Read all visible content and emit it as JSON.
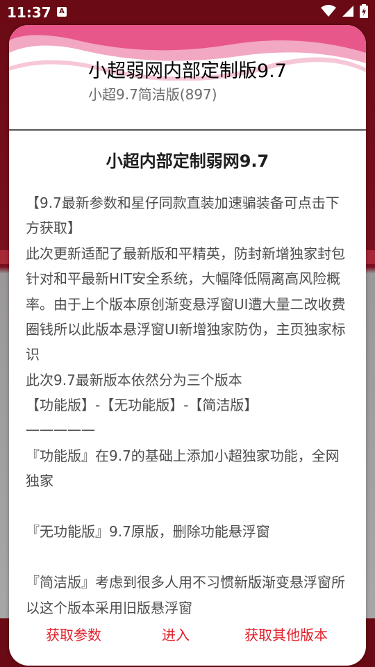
{
  "status": {
    "time": "11:37",
    "badge": "A"
  },
  "dialog": {
    "title": "小超弱网内部定制版9.7",
    "subtitle": "小超9.7简洁版(897)",
    "content_title": "小超内部定制弱网9.7",
    "body": "【9.7最新参数和星仔同款直装加速骗装备可点击下方获取】\n此次更新适配了最新版和平精英，防封新增独家封包针对和平最新HIT安全系统，大幅降低隔离高风险概率。由于上个版本原创渐变悬浮窗UI遭大量二改收费圈钱所以此版本悬浮窗UI新增独家防伪，主页独家标识\n此次9.7最新版本依然分为三个版本\n【功能版】-【无功能版】-【简洁版】\n一一一一一\n『功能版』在9.7的基础上添加小超独家功能，全网独家\n\n『无功能版』9.7原版，删除功能悬浮窗\n\n『简洁版』考虑到很多人用不习惯新版渐变悬浮窗所以这个版本采用旧版悬浮窗",
    "actions": [
      "获取参数",
      "进入",
      "获取其他版本"
    ]
  },
  "colors": {
    "accent": "#e0202a",
    "header_wave": "#e8578a"
  }
}
